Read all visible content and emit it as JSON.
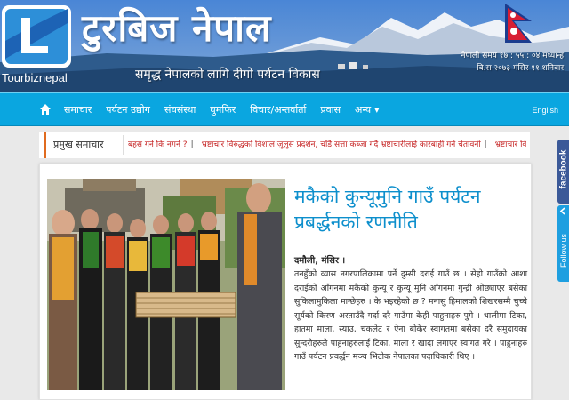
{
  "brand": {
    "logo_caption": "Tourbiznepal",
    "title": "टुरबिज नेपाल",
    "tagline": "समृद्ध नेपालको लागि दीगो पर्यटन विकास",
    "accent_color": "#0aa6e0",
    "headline_color": "#0d8fcc"
  },
  "date": {
    "line1": "नेपाली समय १७ : ५५ : ०४ मध्यान्ह",
    "line2": "वि.स २०७३ मंसिर ११ शनिवार"
  },
  "nav": {
    "items": [
      {
        "label": "समाचार"
      },
      {
        "label": "पर्यटन उद्योग"
      },
      {
        "label": "संघसंस्था"
      },
      {
        "label": "घुमफिर"
      },
      {
        "label": "विचार/अन्तर्वार्ता"
      },
      {
        "label": "प्रवास"
      },
      {
        "label": "अन्य"
      }
    ],
    "english": "English",
    "home_icon": "home-icon",
    "more_icon": "caret-down-icon"
  },
  "ticker": {
    "label": "प्रमुख समाचार",
    "items": [
      {
        "text": "बहस गर्ने कि नगर्ने ?"
      },
      {
        "text": "भ्रष्टाचार विरुद्धको विशाल जुलुस प्रदर्शन, चाँडै सत्ता कब्जा गर्दै भ्रष्टाचारीलाई कारबाही गर्ने चेतावनी"
      },
      {
        "text": "भ्रष्टाचार विरुद्धको विशाल विरोध र्‍यालीं"
      }
    ]
  },
  "article": {
    "headline": "मकैको कुन्यूमुनि गाउँ पर्यटन प्रबर्द्धनको रणनीति",
    "dateline": "दमौली, मंसिर ।",
    "body": "तनहुँको व्यास नगरपालिकामा पर्ने दुम्सी दराई गाउँ छ । सेहो गाउँको आशा दराईको आँगनमा मकैको कुन्यू र कुन्यू मुनि आँगनमा गुन्द्री ओछ्याएर बसेका सुकिलामुकिला मान्छेहरु । के भइरहेको छ ? मनासु हिमालको शिखरसम्मै चुच्चे सूर्यको किरण अस्ताउँदै गर्दा दरै गाउँमा केही पाहुनाहरु पुगे । थालीमा टिका, हातमा माला, स्याउ, चकलेट र ऐना बोकेर स्वागतमा बसेका दरै समुदायका सुन्दरीहरुले पाहुनाहरुलाई टिका, माला र खादा लगाएर स्वागत गरे । पाहुनाहरु गाउँ पर्यटन प्रवर्द्धन मञ्च भिटोक नेपालका पदाधिकारी थिए ।"
  },
  "social": {
    "facebook": "facebook",
    "follow": "Follow us"
  }
}
